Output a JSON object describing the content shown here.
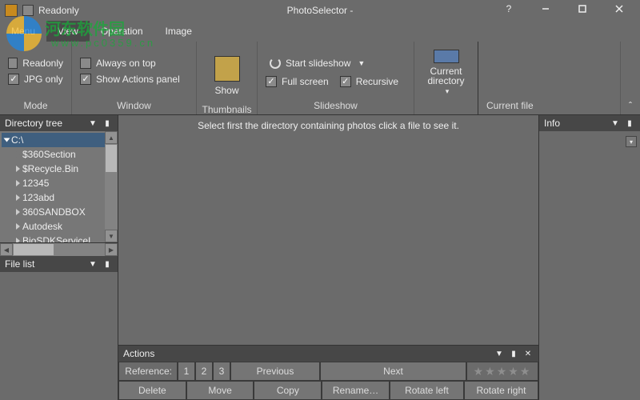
{
  "window": {
    "title": "PhotoSelector -"
  },
  "titlebar": {
    "readonly_label": "Readonly"
  },
  "menus": {
    "menu": "Menu",
    "view": "View",
    "operation": "Operation",
    "image": "Image"
  },
  "ribbon": {
    "mode": {
      "label": "Mode",
      "readonly": "Readonly",
      "jpg_only": "JPG only"
    },
    "window": {
      "label": "Window",
      "always_on_top": "Always on top",
      "show_actions": "Show Actions panel"
    },
    "thumbnails": {
      "label": "Thumbnails",
      "show": "Show"
    },
    "slideshow": {
      "label": "Slideshow",
      "start": "Start slideshow",
      "full_screen": "Full screen",
      "recursive": "Recursive"
    },
    "current": {
      "label": "Current file",
      "current_dir": "Current directory"
    }
  },
  "panels": {
    "directory_tree": "Directory tree",
    "file_list": "File list",
    "actions": "Actions",
    "info": "Info"
  },
  "tree": {
    "root": "C:\\",
    "items": [
      "$360Section",
      "$Recycle.Bin",
      "12345",
      "123abd",
      "360SANDBOX",
      "Autodesk",
      "BioSDKServiceI"
    ]
  },
  "viewer": {
    "placeholder": "Select first the directory containing photos click a file to see it."
  },
  "actions": {
    "reference": "Reference:",
    "nums": [
      "1",
      "2",
      "3"
    ],
    "previous": "Previous",
    "next": "Next",
    "delete": "Delete",
    "move": "Move",
    "copy": "Copy",
    "rename": "Rename…",
    "rotate_left": "Rotate left",
    "rotate_right": "Rotate right",
    "stars": "★★★★★"
  },
  "watermark": {
    "line1": "河东软件园",
    "line2": "www.pc0359.cn"
  }
}
